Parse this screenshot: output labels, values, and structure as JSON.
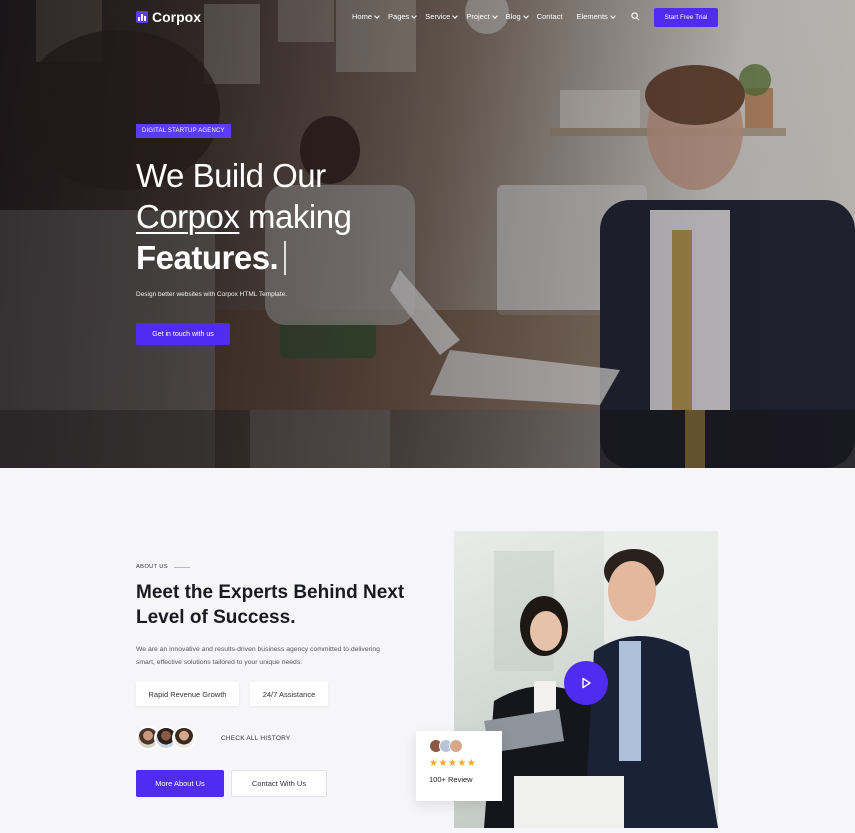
{
  "nav": {
    "logo": "Corpox",
    "links": [
      {
        "label": "Home",
        "dropdown": true
      },
      {
        "label": "Pages",
        "dropdown": true
      },
      {
        "label": "Service",
        "dropdown": true
      },
      {
        "label": "Project",
        "dropdown": true
      },
      {
        "label": "Blog",
        "dropdown": true
      },
      {
        "label": "Contact",
        "dropdown": false
      },
      {
        "label": "Elements",
        "dropdown": true
      }
    ],
    "cta": "Start Free Trial"
  },
  "hero": {
    "badge": "DIGITAL STARTUP AGENCY",
    "title_line1": "We Build Our",
    "title_brand": "Corpox",
    "title_line2_rest": " making",
    "title_line3": "Features.",
    "subtitle": "Design better websites with Corpox HTML Template.",
    "button": "Get in touch with us"
  },
  "about": {
    "label": "ABOUT US",
    "title": "Meet the Experts Behind Next Level of Success.",
    "text": "We are an innovative and results-driven business agency committed to delivering smart, effective solutions tailored to your unique needs.",
    "pill1": "Rapid Revenue Growth",
    "pill2": "24/7 Assistance",
    "history": "CHECK ALL HISTORY",
    "btn_primary": "More About Us",
    "btn_secondary": "Contact With Us"
  },
  "review": {
    "stars": "★★★★★",
    "label": "100+ Review"
  },
  "colors": {
    "accent": "#4f2cf0",
    "star": "#f5a623"
  }
}
